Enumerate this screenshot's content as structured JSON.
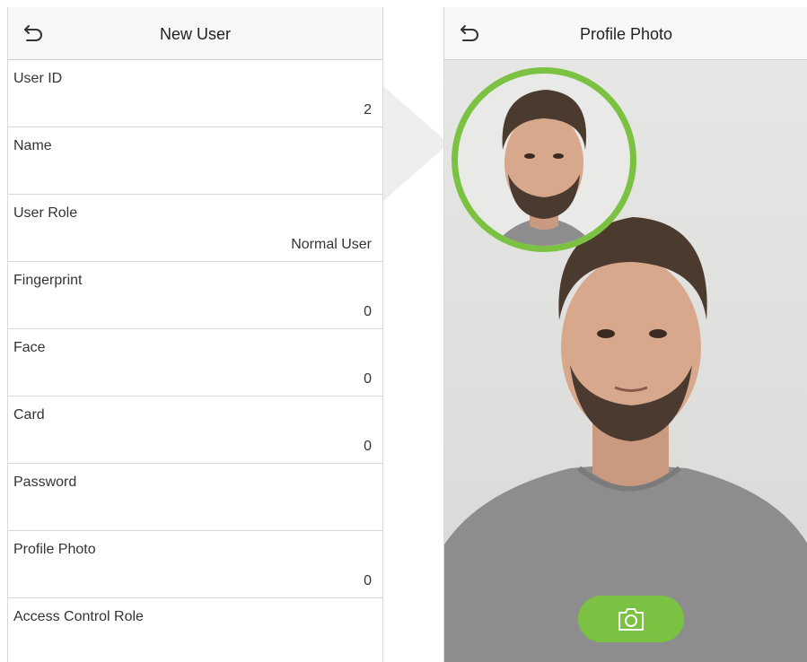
{
  "left_panel": {
    "title": "New User",
    "rows": [
      {
        "label": "User ID",
        "value": "2"
      },
      {
        "label": "Name",
        "value": ""
      },
      {
        "label": "User Role",
        "value": "Normal User"
      },
      {
        "label": "Fingerprint",
        "value": "0"
      },
      {
        "label": "Face",
        "value": "0"
      },
      {
        "label": "Card",
        "value": "0"
      },
      {
        "label": "Password",
        "value": ""
      },
      {
        "label": "Profile Photo",
        "value": "0"
      },
      {
        "label": "Access Control Role",
        "value": ""
      }
    ]
  },
  "right_panel": {
    "title": "Profile Photo",
    "capture_icon": "camera-icon"
  },
  "icons": {
    "back": "back-arrow-icon"
  },
  "colors": {
    "accent": "#7cc242",
    "titlebar_bg": "#f7f7f7"
  }
}
